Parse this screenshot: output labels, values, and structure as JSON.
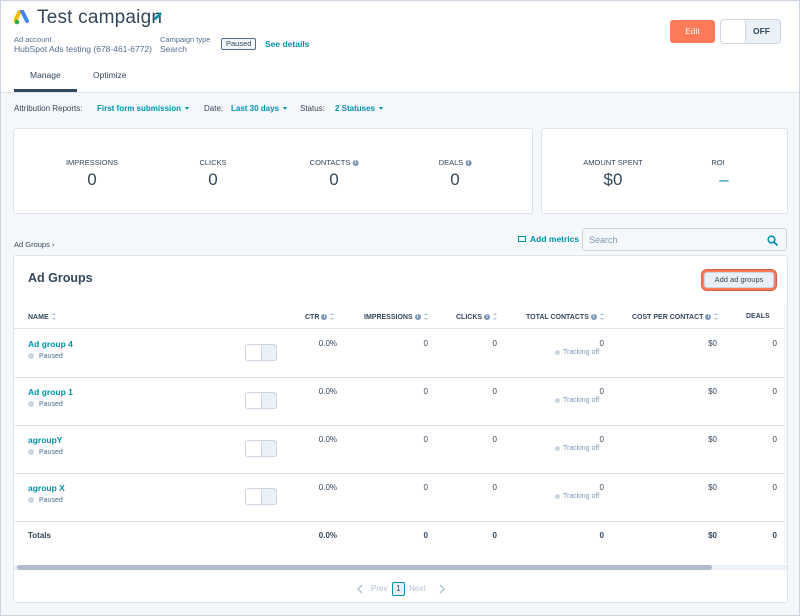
{
  "header": {
    "title": "Test campaign",
    "ad_account_label": "Ad account",
    "ad_account_value": "HubSpot Ads testing (678-461-6772)",
    "campaign_type_label": "Campaign type",
    "campaign_type_value": "Search",
    "status_badge": "Paused",
    "see_details": "See details",
    "edit_label": "Edit",
    "toggle_label": "OFF",
    "tabs": [
      {
        "label": "Manage",
        "active": true
      },
      {
        "label": "Optimize",
        "active": false
      }
    ]
  },
  "filters": {
    "attribution_label": "Attribution Reports:",
    "attribution_value": "First form submission",
    "date_label": "Date:",
    "date_value": "Last 30 days",
    "status_label": "Status:",
    "status_value": "2 Statuses"
  },
  "stats": {
    "impressions_label": "IMPRESSIONS",
    "impressions_value": "0",
    "clicks_label": "CLICKS",
    "clicks_value": "0",
    "contacts_label": "CONTACTS",
    "contacts_value": "0",
    "deals_label": "DEALS",
    "deals_value": "0",
    "amount_spent_label": "AMOUNT SPENT",
    "amount_spent_value": "$0",
    "roi_label": "ROI",
    "roi_value": "–"
  },
  "toolbar": {
    "breadcrumb": "Ad Groups",
    "add_metrics": "Add metrics",
    "search_placeholder": "Search"
  },
  "table": {
    "title": "Ad Groups",
    "add_button": "Add ad groups",
    "columns": {
      "name": "NAME",
      "ctr": "CTR",
      "impressions": "IMPRESSIONS",
      "clicks": "CLICKS",
      "total_contacts": "TOTAL CONTACTS",
      "cost_per_contact": "COST PER CONTACT",
      "deals": "DEALS"
    },
    "rows": [
      {
        "name": "Ad group 4",
        "status": "Paused",
        "ctr": "0.0%",
        "impressions": "0",
        "clicks": "0",
        "contacts": "0",
        "tracking": "Tracking off",
        "cost": "$0",
        "deals": "0"
      },
      {
        "name": "Ad group 1",
        "status": "Paused",
        "ctr": "0.0%",
        "impressions": "0",
        "clicks": "0",
        "contacts": "0",
        "tracking": "Tracking off",
        "cost": "$0",
        "deals": "0"
      },
      {
        "name": "agroupY",
        "status": "Paused",
        "ctr": "0.0%",
        "impressions": "0",
        "clicks": "0",
        "contacts": "0",
        "tracking": "Tracking off",
        "cost": "$0",
        "deals": "0"
      },
      {
        "name": "agroup X",
        "status": "Paused",
        "ctr": "0.0%",
        "impressions": "0",
        "clicks": "0",
        "contacts": "0",
        "tracking": "Tracking off",
        "cost": "$0",
        "deals": "0"
      }
    ],
    "totals": {
      "label": "Totals",
      "ctr": "0.0%",
      "impressions": "0",
      "clicks": "0",
      "contacts": "0",
      "cost": "$0",
      "deals": "0"
    }
  },
  "pagination": {
    "prev": "Prev",
    "page": "1",
    "next": "Next"
  },
  "colors": {
    "accent": "#0091ae",
    "edit_button": "#ff7a59",
    "text": "#33475b",
    "background": "#f5f8fa"
  }
}
